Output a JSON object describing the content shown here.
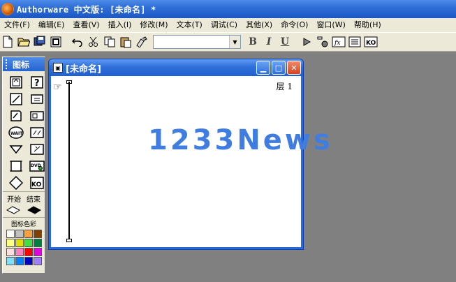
{
  "app": {
    "title": "Authorware 中文版: [未命名] *"
  },
  "menu": [
    {
      "label": "文件(F)"
    },
    {
      "label": "编辑(E)"
    },
    {
      "label": "查看(V)"
    },
    {
      "label": "插入(I)"
    },
    {
      "label": "修改(M)"
    },
    {
      "label": "文本(T)"
    },
    {
      "label": "调试(C)"
    },
    {
      "label": "其他(X)"
    },
    {
      "label": "命令(O)"
    },
    {
      "label": "窗口(W)"
    },
    {
      "label": "帮助(H)"
    }
  ],
  "toolbar": {
    "font_value": "",
    "bold": "B",
    "italic": "I",
    "underline": "U",
    "fn_label": "fx",
    "ko_label": "KO"
  },
  "palette": {
    "title": "图标",
    "start_label": "开始",
    "end_label": "结束",
    "color_title": "图标色彩",
    "wait_label": "WAIT",
    "dvd_label": "DVD",
    "ko_label": "KO",
    "swatches": [
      "#ffffff",
      "#c0c0c0",
      "#ffa040",
      "#804000",
      "#ffff80",
      "#e0e000",
      "#40e040",
      "#008040",
      "#ffe0e0",
      "#ff80c0",
      "#ff0000",
      "#e000e0",
      "#80e0ff",
      "#0080ff",
      "#0000c0",
      "#a080ff"
    ]
  },
  "window": {
    "title": "[未命名]",
    "layer": "层 1"
  },
  "watermark": "1233News"
}
